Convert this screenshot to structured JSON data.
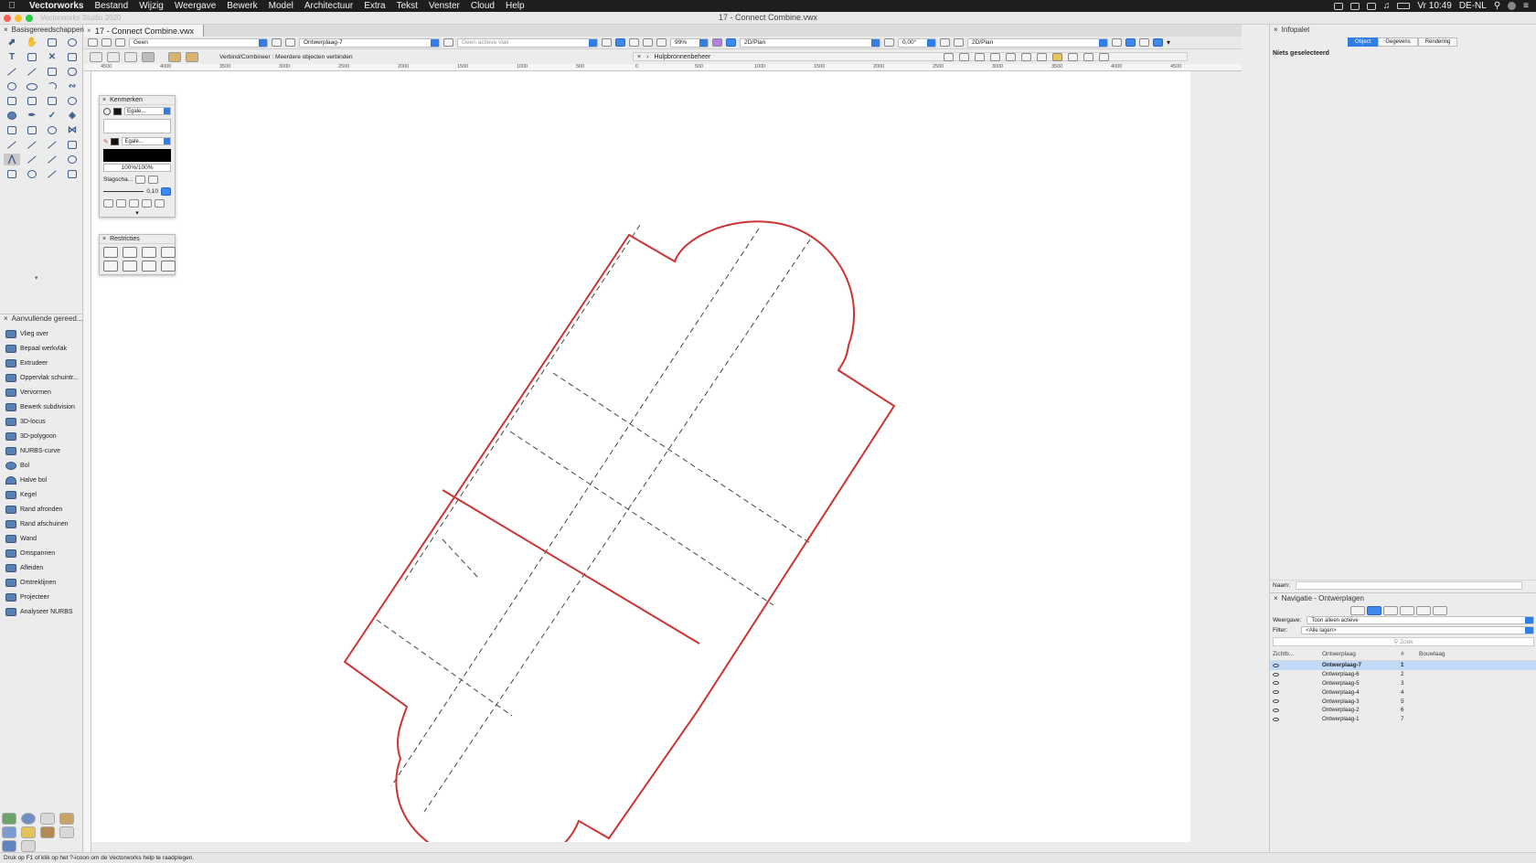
{
  "menubar": {
    "app": "Vectorworks",
    "items": [
      "Bestand",
      "Wijzig",
      "Weergave",
      "Bewerk",
      "Model",
      "Architectuur",
      "Extra",
      "Tekst",
      "Venster",
      "Cloud",
      "Help"
    ],
    "clock": "Vr 10:49",
    "locale": "DE-NL"
  },
  "window": {
    "app_title": "Vectorworks Studio 2020",
    "doc_title": "17 - Connect Combine.vwx",
    "tab": "17 - Connect Combine.vwx"
  },
  "left_palette": {
    "title": "Basisgereedschappen",
    "additional_title": "Aanvullende gereed...",
    "additional_tools": [
      "Vlieg over",
      "Bepaal werkvlak",
      "Extrudeer",
      "Oppervlak schuintr...",
      "Vervormen",
      "Bewerk subdivision",
      "3D-locus",
      "3D-polygoon",
      "NURBS-curve",
      "Bol",
      "Halve bol",
      "Kegel",
      "Rand afronden",
      "Rand afschuinen",
      "Wand",
      "Omspannen",
      "Afleiden",
      "Omtreklijnen",
      "Projecteer",
      "Analyseer NURBS"
    ]
  },
  "view_bar": {
    "class": "Geen",
    "layer": "Ontwerplaag-7",
    "plane": "Geen actieve vlak",
    "zoom": "99%",
    "view": "2D/Plan",
    "rotation": "0,00°",
    "render": "2D/Plan"
  },
  "mode_bar": {
    "mode_text": "Verbind/Combineer : Meerdere objecten verbinden",
    "resource_manager": "Hulpbronnenbeheer"
  },
  "attributes": {
    "title": "Kenmerken",
    "fill_style": "Egale...",
    "pen_style": "Egale...",
    "opacity": "100%/100%",
    "shadow_label": "Slagscha...",
    "line_weight": "0,10"
  },
  "constraints": {
    "title": "Restricties"
  },
  "info_palette": {
    "title": "Infopalet",
    "tabs": [
      "Object",
      "Gegevens",
      "Rendering"
    ],
    "active_tab": "Object",
    "status": "Niets geselecteerd",
    "name_label": "Naam:"
  },
  "navigation": {
    "title": "Navigatie - Ontwerplagen",
    "view_label": "Weergave:",
    "view_value": "Toon alleen actieve",
    "filter_label": "Filter:",
    "filter_value": "<Alle lagen>",
    "search_placeholder": "Zoek",
    "columns": [
      "Zichtb...",
      "Ontwerplaag",
      "#",
      "Bouwlaag"
    ],
    "layers": [
      {
        "name": "Ontwerplaag-7",
        "num": "1"
      },
      {
        "name": "Ontwerplaag-6",
        "num": "2"
      },
      {
        "name": "Ontwerplaag-5",
        "num": "3"
      },
      {
        "name": "Ontwerplaag-4",
        "num": "4"
      },
      {
        "name": "Ontwerplaag-3",
        "num": "5"
      },
      {
        "name": "Ontwerplaag-2",
        "num": "6"
      },
      {
        "name": "Ontwerplaag-1",
        "num": "7"
      }
    ]
  },
  "rulers": {
    "h_labels": [
      "4500",
      "4000",
      "3500",
      "3000",
      "2500",
      "2000",
      "1500",
      "1000",
      "500",
      "0",
      "500",
      "1000",
      "1500",
      "2000",
      "2500",
      "3000",
      "3500",
      "4000",
      "4500"
    ]
  },
  "status_bar": "Druk op F1 of klik op het ?-icoon om de Vectorworks help te raadplegen.",
  "colors": {
    "accent": "#2f7ee8",
    "shape_outline": "#cc3333",
    "dash": "#444444"
  }
}
